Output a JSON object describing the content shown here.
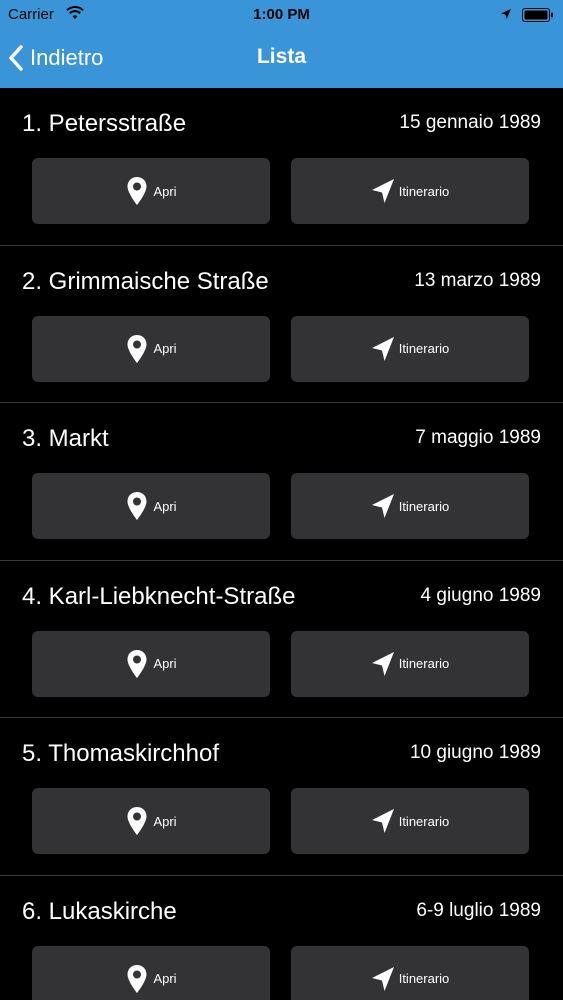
{
  "status_bar": {
    "carrier": "Carrier",
    "time": "1:00 PM",
    "icons": [
      "wifi-icon",
      "location-arrow-icon",
      "battery-icon"
    ]
  },
  "nav": {
    "back_label": "Indietro",
    "title": "Lista"
  },
  "colors": {
    "header_bg": "#3a95d8",
    "background": "#000000",
    "button_bg": "#333336"
  },
  "items": [
    {
      "title": "1. Petersstraße",
      "date": "15 gennaio 1989",
      "open_label": "Apri",
      "route_label": "Itinerario"
    },
    {
      "title": "2. Grimmaische Straße",
      "date": "13 marzo 1989",
      "open_label": "Apri",
      "route_label": "Itinerario"
    },
    {
      "title": "3. Markt",
      "date": "7 maggio 1989",
      "open_label": "Apri",
      "route_label": "Itinerario"
    },
    {
      "title": "4. Karl-Liebknecht-Straße",
      "date": "4 giugno 1989",
      "open_label": "Apri",
      "route_label": "Itinerario"
    },
    {
      "title": "5. Thomaskirchhof",
      "date": "10 giugno 1989",
      "open_label": "Apri",
      "route_label": "Itinerario"
    },
    {
      "title": "6. Lukaskirche",
      "date": "6-9 luglio 1989",
      "open_label": "Apri",
      "route_label": "Itinerario"
    }
  ]
}
